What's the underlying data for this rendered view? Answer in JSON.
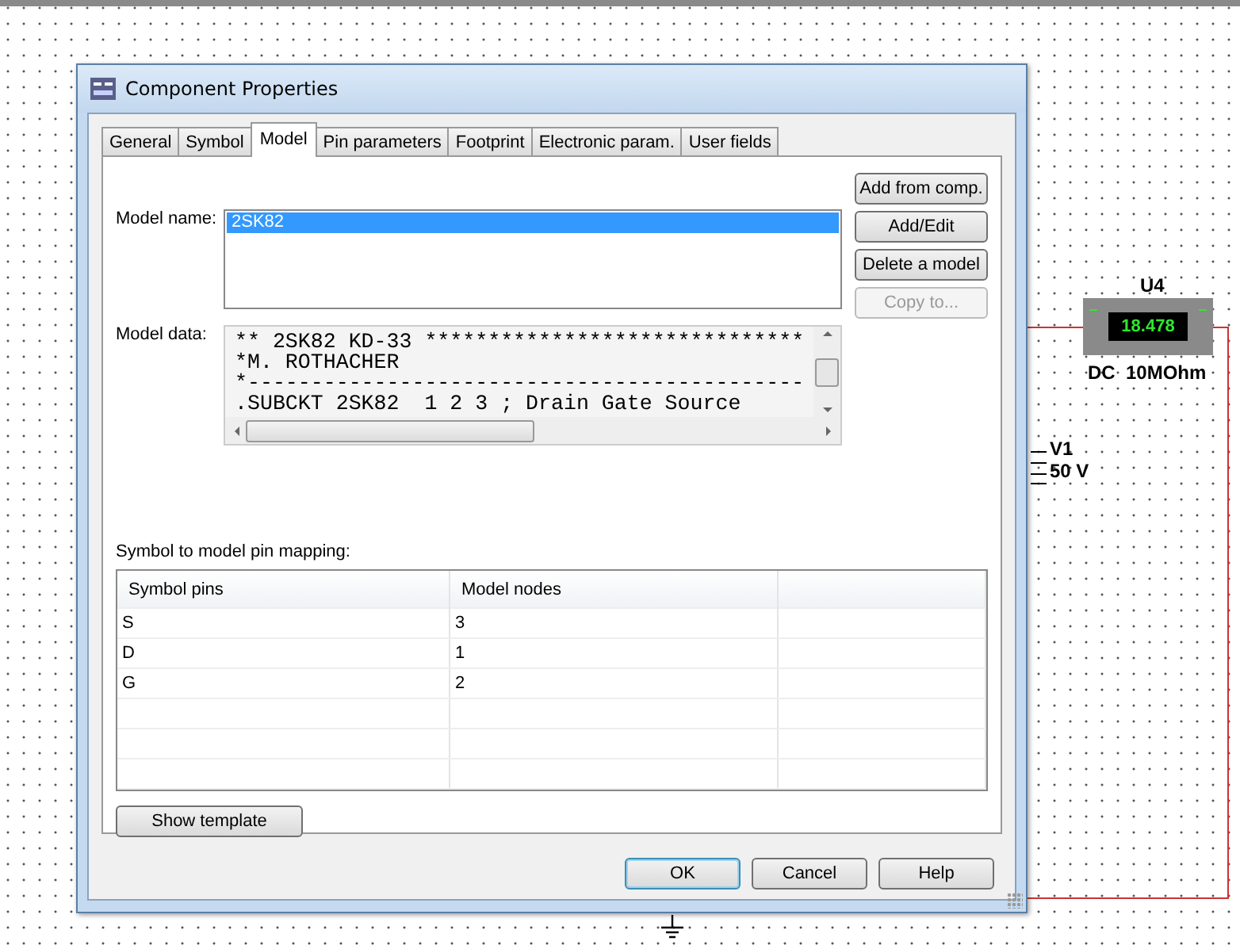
{
  "window": {
    "title": "Component Properties"
  },
  "tabs": [
    {
      "label": "General",
      "selected": false
    },
    {
      "label": "Symbol",
      "selected": false
    },
    {
      "label": "Model",
      "selected": true
    },
    {
      "label": "Pin parameters",
      "selected": false
    },
    {
      "label": "Footprint",
      "selected": false
    },
    {
      "label": "Electronic param.",
      "selected": false
    },
    {
      "label": "User fields",
      "selected": false
    }
  ],
  "model_name": {
    "label": "Model name:",
    "items": [
      {
        "text": "2SK82",
        "selected": true
      }
    ]
  },
  "model_buttons": [
    {
      "label": "Add from comp.",
      "disabled": false
    },
    {
      "label": "Add/Edit",
      "disabled": false
    },
    {
      "label": "Delete a model",
      "disabled": false
    },
    {
      "label": "Copy to...",
      "disabled": true
    }
  ],
  "model_data": {
    "label": "Model data:",
    "lines": [
      "** 2SK82 KD-33 ******************************",
      "*M. ROTHACHER",
      "*--------------------------------------------",
      ".SUBCKT 2SK82  1 2 3 ; Drain Gate Source"
    ]
  },
  "pin_mapping": {
    "label": "Symbol to model pin mapping:",
    "columns": [
      "Symbol pins",
      "Model nodes"
    ],
    "rows": [
      [
        "S",
        "3"
      ],
      [
        "D",
        "1"
      ],
      [
        "G",
        "2"
      ]
    ]
  },
  "template_button": {
    "label": "Show template"
  },
  "footer_buttons": [
    {
      "label": "OK",
      "default": true
    },
    {
      "label": "Cancel",
      "default": false
    },
    {
      "label": "Help",
      "default": false
    }
  ],
  "schematic": {
    "meter": {
      "ref": "U4",
      "reading": "18.478",
      "setting": "DC  10MOhm"
    },
    "source": {
      "ref": "V1",
      "value": "50 V"
    }
  }
}
